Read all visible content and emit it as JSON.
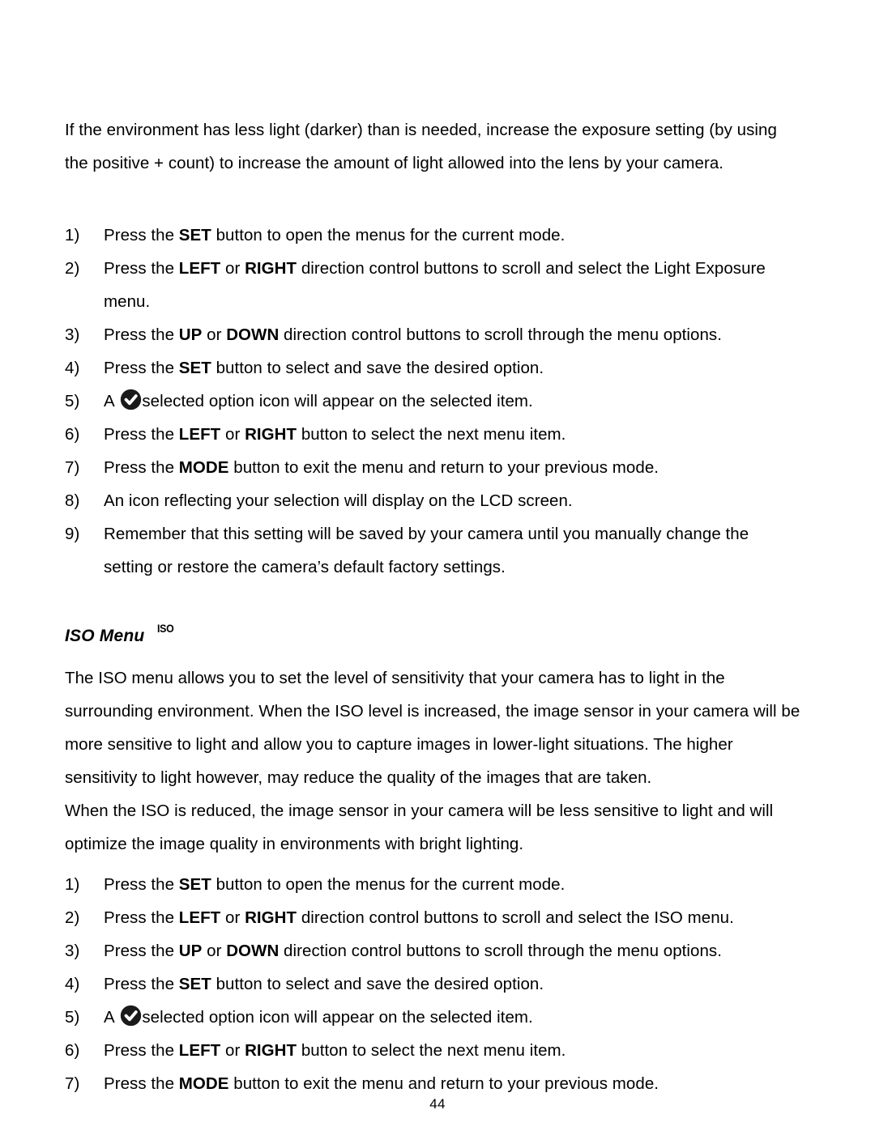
{
  "page": {
    "number": "44"
  },
  "intro_paragraph": "If the environment has less light (darker) than is needed, increase the exposure setting (by using the positive + count) to increase the amount of light allowed into the lens by your camera.",
  "exposure_steps": [
    {
      "num": "1)",
      "pre": "Press the ",
      "bold1": "SET",
      "mid": " button to open the menus for the current mode.",
      "bold2": "",
      "post": ""
    },
    {
      "num": "2)",
      "pre": "Press the ",
      "bold1": "LEFT",
      "mid": " or ",
      "bold2": "RIGHT",
      "post": " direction control buttons to scroll and select the Light Exposure menu."
    },
    {
      "num": "3)",
      "pre": "Press the ",
      "bold1": "UP",
      "mid": " or ",
      "bold2": "DOWN",
      "post": " direction control buttons to scroll through the menu options."
    },
    {
      "num": "4)",
      "pre": "Press the ",
      "bold1": "SET",
      "mid": " button to select and save the desired option.",
      "bold2": "",
      "post": ""
    },
    {
      "num": "5)",
      "pre": "A ",
      "bold1": "",
      "mid": "",
      "bold2": "",
      "post": "selected option icon will appear on the selected item.",
      "icon": "checkmark-icon"
    },
    {
      "num": "6)",
      "pre": "Press the ",
      "bold1": "LEFT",
      "mid": " or ",
      "bold2": "RIGHT",
      "post": " button to select the next menu item."
    },
    {
      "num": "7)",
      "pre": "Press the ",
      "bold1": "MODE",
      "mid": " button to exit the menu and return to your previous mode.",
      "bold2": "",
      "post": ""
    },
    {
      "num": "8)",
      "pre": "An icon reflecting your selection will display on the LCD screen.",
      "bold1": "",
      "mid": "",
      "bold2": "",
      "post": ""
    },
    {
      "num": "9)",
      "pre": "Remember that this setting will be saved by your camera until you manually change the setting or restore the camera’s default factory settings.",
      "bold1": "",
      "mid": "",
      "bold2": "",
      "post": ""
    }
  ],
  "iso_section": {
    "heading": "ISO Menu",
    "heading_icon_label": "ISO",
    "paragraph_1": "The ISO menu allows you to set the level of sensitivity that your camera has to light in the surrounding environment. When the ISO level is increased, the image sensor in your camera will be more sensitive to light and allow you to capture images in lower-light situations. The higher sensitivity to light however, may reduce the quality of the images that are taken.",
    "paragraph_2": "When the ISO is reduced, the image sensor in your camera will be less sensitive to light and will optimize the image quality in environments with bright lighting.",
    "steps": [
      {
        "num": "1)",
        "pre": "Press the ",
        "bold1": "SET",
        "mid": " button to open the menus for the current mode.",
        "bold2": "",
        "post": ""
      },
      {
        "num": "2)",
        "pre": "Press the ",
        "bold1": "LEFT",
        "mid": " or ",
        "bold2": "RIGHT",
        "post": " direction control buttons to scroll and select the ISO menu."
      },
      {
        "num": "3)",
        "pre": "Press the ",
        "bold1": "UP",
        "mid": " or ",
        "bold2": "DOWN",
        "post": " direction control buttons to scroll through the menu options."
      },
      {
        "num": "4)",
        "pre": "Press the ",
        "bold1": "SET",
        "mid": " button to select and save the desired option.",
        "bold2": "",
        "post": ""
      },
      {
        "num": "5)",
        "pre": "A ",
        "bold1": "",
        "mid": "",
        "bold2": "",
        "post": "selected option icon will appear on the selected item.",
        "icon": "checkmark-icon"
      },
      {
        "num": "6)",
        "pre": "Press the ",
        "bold1": "LEFT",
        "mid": " or ",
        "bold2": "RIGHT",
        "post": " button to select the next menu item."
      },
      {
        "num": "7)",
        "pre": "Press the ",
        "bold1": "MODE",
        "mid": " button to exit the menu and return to your previous mode.",
        "bold2": "",
        "post": ""
      }
    ]
  },
  "colors": {
    "text": "#000000",
    "background": "#ffffff",
    "icon_fill": "#1a1a1a"
  }
}
